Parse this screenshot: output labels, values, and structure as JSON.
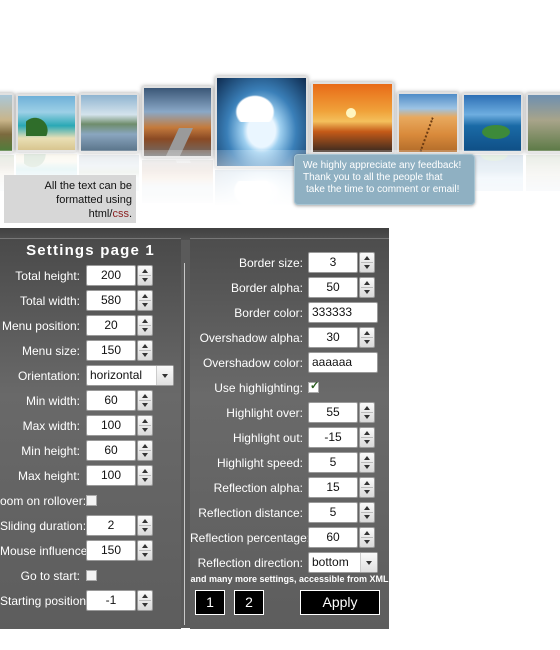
{
  "gallery": {
    "note": {
      "line1": "All the text can be",
      "line2": "formatted using",
      "line3_prefix": "html/",
      "line3_css": "css",
      "line3_suffix": "."
    },
    "bubble": {
      "line1": "We highly appreciate any feedback!",
      "line2": "Thank you to all the people that",
      "line3": "take the time to comment or email!"
    }
  },
  "settings": {
    "title": "Settings page 1",
    "left": [
      {
        "label": "Total height:",
        "type": "number",
        "value": "200"
      },
      {
        "label": "Total width:",
        "type": "number",
        "value": "580"
      },
      {
        "label": "Menu position:",
        "type": "number",
        "value": "20"
      },
      {
        "label": "Menu size:",
        "type": "number",
        "value": "150"
      },
      {
        "label": "Orientation:",
        "type": "select",
        "value": "horizontal"
      },
      {
        "label": "Min width:",
        "type": "number",
        "value": "60"
      },
      {
        "label": "Max width:",
        "type": "number",
        "value": "100"
      },
      {
        "label": "Min height:",
        "type": "number",
        "value": "60"
      },
      {
        "label": "Max height:",
        "type": "number",
        "value": "100"
      },
      {
        "label": "oom on rollover:",
        "type": "checkbox",
        "checked": false
      },
      {
        "label": "Sliding duration:",
        "type": "number",
        "value": "2"
      },
      {
        "label": "Mouse influence:",
        "type": "number",
        "value": "150"
      },
      {
        "label": "Go to start:",
        "type": "checkbox",
        "checked": false
      },
      {
        "label": "Starting position:",
        "type": "number",
        "value": "-1"
      }
    ],
    "right": [
      {
        "label": "Border size:",
        "type": "number",
        "value": "3"
      },
      {
        "label": "Border alpha:",
        "type": "number",
        "value": "50"
      },
      {
        "label": "Border color:",
        "type": "text",
        "value": "333333"
      },
      {
        "label": "Overshadow alpha:",
        "type": "number",
        "value": "30"
      },
      {
        "label": "Overshadow color:",
        "type": "text",
        "value": "aaaaaa"
      },
      {
        "label": "Use highlighting:",
        "type": "checkbox",
        "checked": true
      },
      {
        "label": "Highlight over:",
        "type": "number",
        "value": "55"
      },
      {
        "label": "Highlight out:",
        "type": "number",
        "value": "-15"
      },
      {
        "label": "Highlight speed:",
        "type": "number",
        "value": "5"
      },
      {
        "label": "Reflection alpha:",
        "type": "number",
        "value": "15"
      },
      {
        "label": "Reflection distance:",
        "type": "number",
        "value": "5"
      },
      {
        "label": "Reflection percentage:",
        "type": "number",
        "value": "60"
      },
      {
        "label": "Reflection direction:",
        "type": "select",
        "value": "bottom"
      }
    ],
    "footnote": "and many more settings, accessible from XML",
    "page1": "1",
    "page2": "2",
    "apply": "Apply"
  }
}
